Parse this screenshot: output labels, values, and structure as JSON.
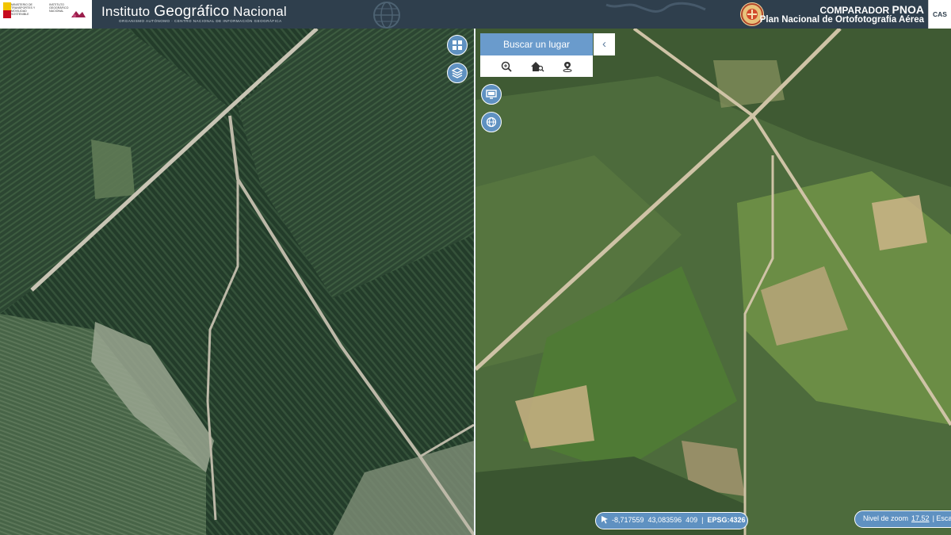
{
  "header": {
    "gov_text_1": "MINISTERIO DE TRANSPORTES Y MOVILIDAD SOSTENIBLE",
    "gov_text_2": "INSTITUTO GEOGRÁFICO NACIONAL",
    "ign_name_1": "Instituto ",
    "ign_name_2": "Geográfico",
    "ign_name_3": " Nacional",
    "ign_subtitle": "ORGANISMO AUTÓNOMO · CENTRO NACIONAL DE INFORMACIÓN GEOGRÁFICA",
    "app_title_prefix": "COMPARADOR ",
    "app_title_strong": "PNOA",
    "app_subtitle": "Plan Nacional de Ortofotografía Aérea",
    "language_button": "CAS"
  },
  "icons": {
    "left_map": [
      "layout-grid-icon",
      "layers-icon"
    ],
    "right_map": [
      "map-panel-icon",
      "globe-icon"
    ],
    "search_tools": [
      "zoom-search-icon",
      "address-search-icon",
      "coordinate-pin-icon"
    ],
    "collapse": "chevron-left-icon",
    "coords": "pointer-icon"
  },
  "search": {
    "title": "Buscar un lugar",
    "collapse_glyph": "‹"
  },
  "status": {
    "longitude": "-8,717559",
    "latitude": "43,083596",
    "elevation": "409",
    "separator": "|",
    "epsg": "EPSG:4326",
    "zoom_label": "Nivel de zoom",
    "zoom_value": "17.52",
    "scale_label": "Esca"
  },
  "colors": {
    "header_bg": "#2f3f4d",
    "button_blue": "#5f91c1",
    "search_blue": "#6a9bcc"
  }
}
